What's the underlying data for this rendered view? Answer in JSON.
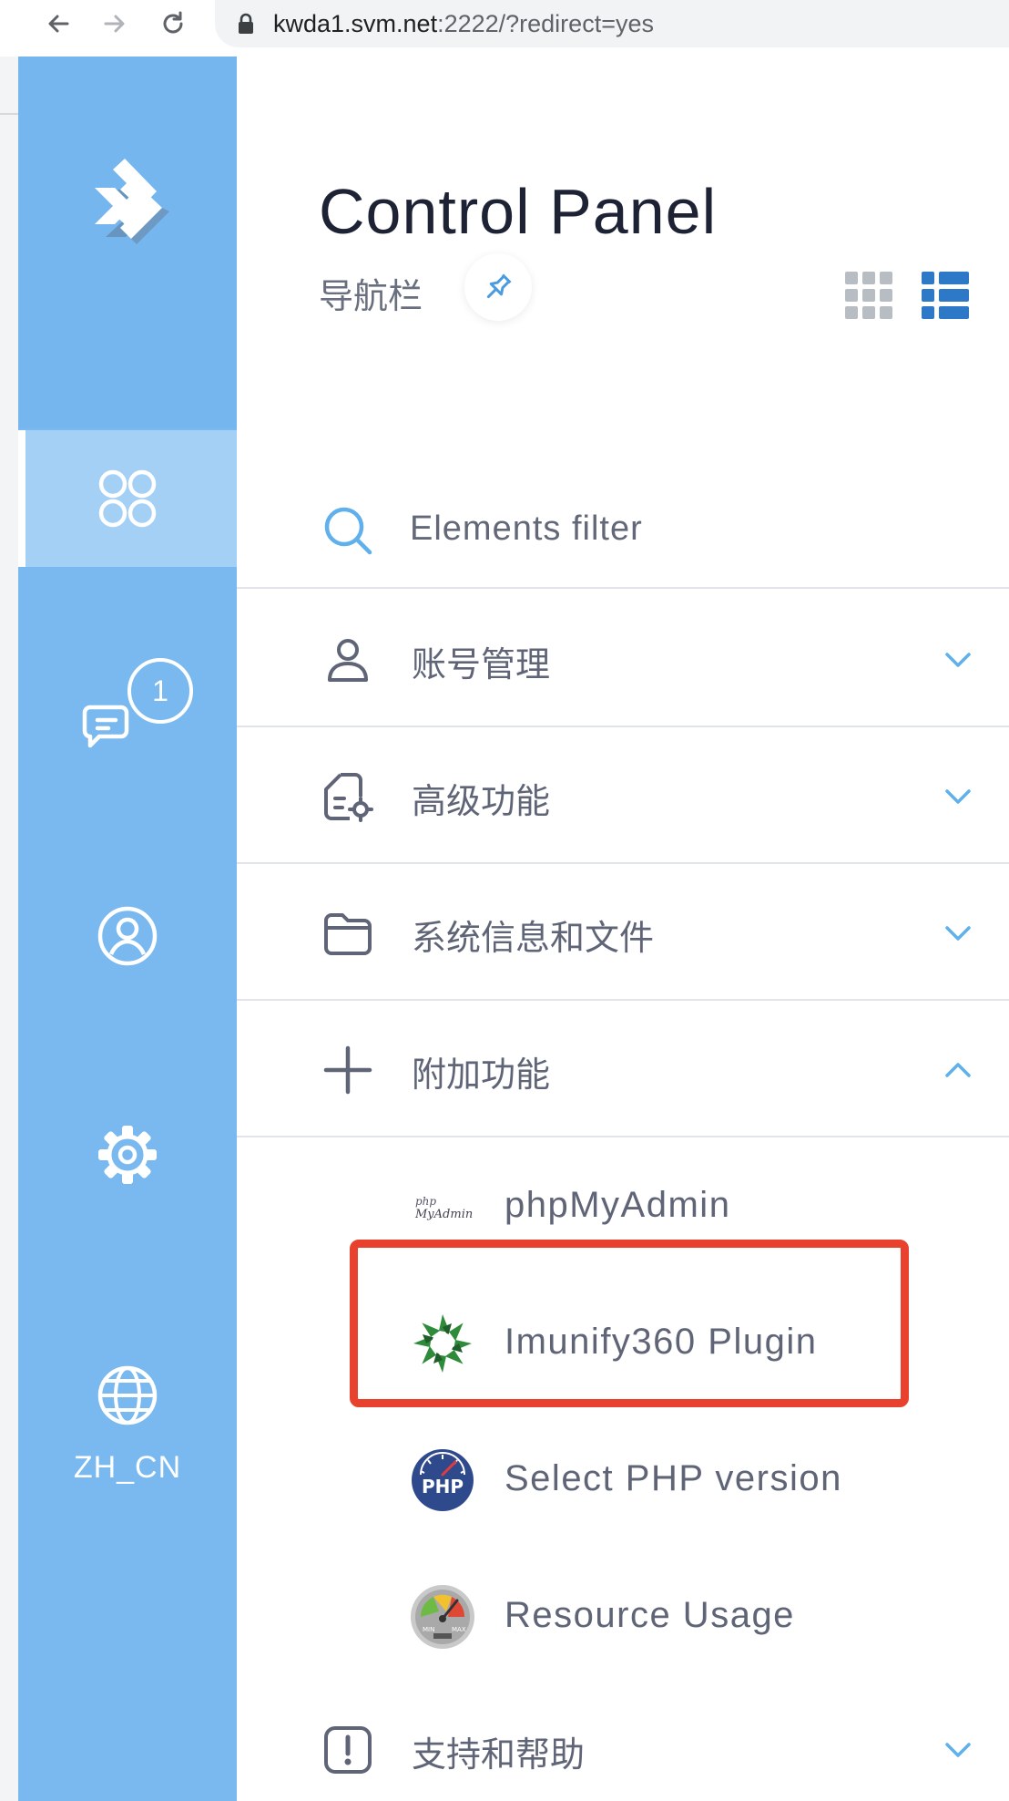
{
  "browser": {
    "url_host": "kwda1.svm.net",
    "url_rest": ":2222/?redirect=yes"
  },
  "sidebar": {
    "items": [
      {
        "name": "dashboard",
        "icon": "grid-circles-icon",
        "active": true
      },
      {
        "name": "messages",
        "icon": "chat-icon",
        "badge": "1"
      },
      {
        "name": "profile",
        "icon": "user-circle-icon"
      },
      {
        "name": "settings",
        "icon": "gear-icon"
      },
      {
        "name": "language",
        "icon": "globe-icon",
        "label": "ZH_CN"
      }
    ]
  },
  "header": {
    "title": "Control Panel",
    "subtitle": "导航栏"
  },
  "filter": {
    "placeholder": "Elements filter"
  },
  "sections": [
    {
      "label": "账号管理",
      "icon": "user-icon",
      "expanded": false
    },
    {
      "label": "高级功能",
      "icon": "document-gear-icon",
      "expanded": false
    },
    {
      "label": "系统信息和文件",
      "icon": "folder-icon",
      "expanded": false
    },
    {
      "label": "附加功能",
      "icon": "plus-icon",
      "expanded": true
    },
    {
      "label": "支持和帮助",
      "icon": "exclamation-icon",
      "expanded": false
    }
  ],
  "extra_items": [
    {
      "label": "phpMyAdmin",
      "icon": "phpmyadmin-icon",
      "icon_text_top": "php",
      "icon_text_bottom": "MyAdmin"
    },
    {
      "label": "Imunify360 Plugin",
      "icon": "imunify360-icon",
      "highlighted": true
    },
    {
      "label": "Select PHP version",
      "icon": "php-icon",
      "icon_text": "PHP"
    },
    {
      "label": "Resource Usage",
      "icon": "gauge-icon",
      "icon_text_min": "MIN",
      "icon_text_max": "MAX"
    }
  ],
  "colors": {
    "sidebar": "#79b9ef",
    "accent": "#2e78c8",
    "highlight": "#e8412e",
    "text": "#5f6577"
  }
}
